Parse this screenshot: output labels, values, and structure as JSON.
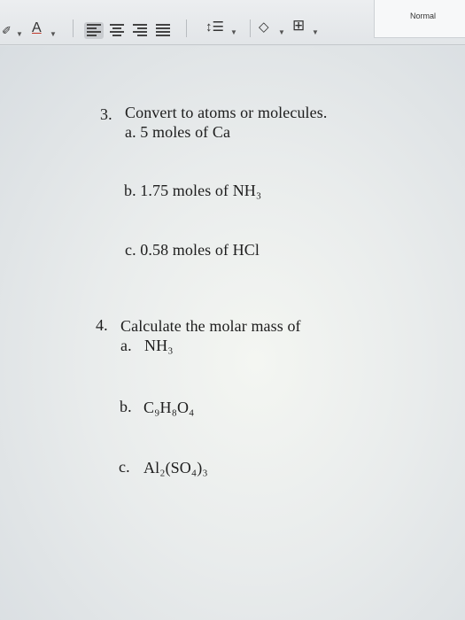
{
  "ribbon": {
    "font_color_letter": "A",
    "style_name": "Normal"
  },
  "document": {
    "lines": [
      "3.",
      "Convert to atoms or molecules.",
      "a. 5 moles of Ca",
      "b. 1.75 moles of NH₃",
      "c. 0.58 moles of HCl",
      "4.",
      "Calculate the molar mass of",
      "a.",
      "NH₃",
      "b.",
      "C₉H₈O₄",
      "c.",
      "Al₂(SO₄)₃"
    ]
  }
}
